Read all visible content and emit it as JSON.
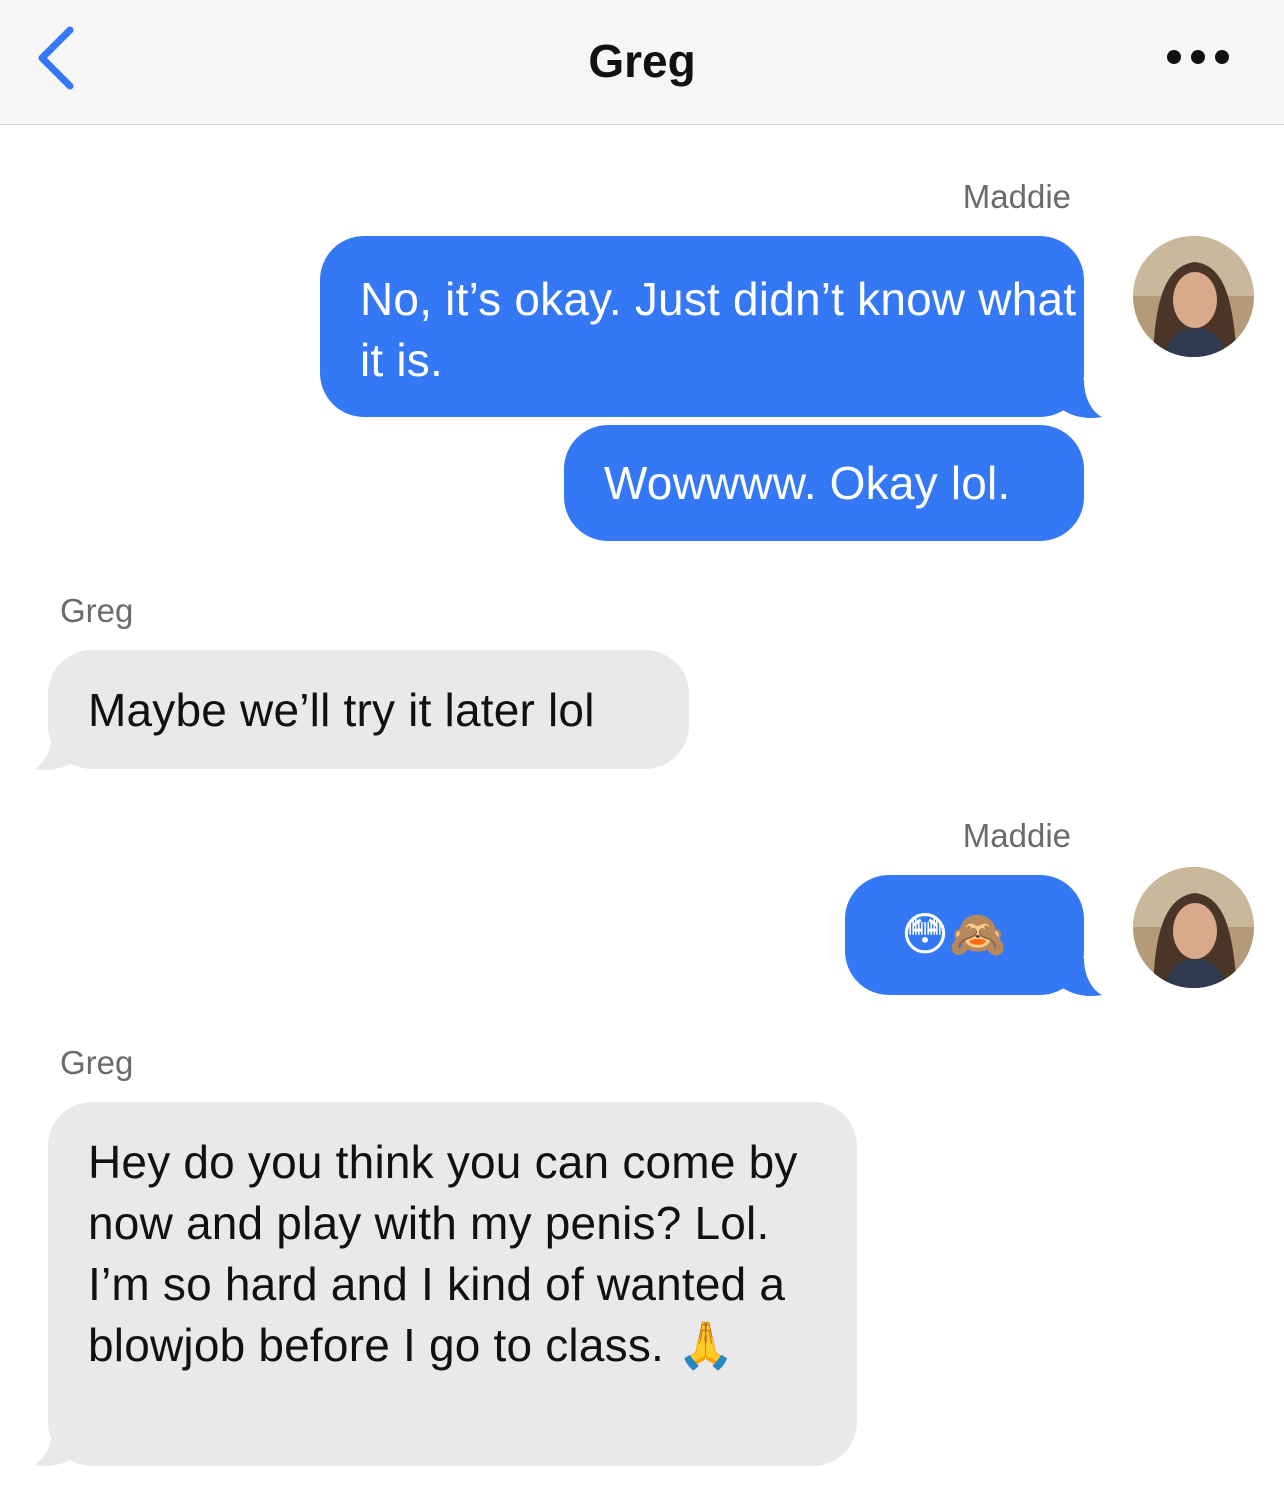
{
  "header": {
    "title": "Greg",
    "back_icon": "chevron-left-icon",
    "more_icon": "ellipsis-icon",
    "accent_color": "#3478f6"
  },
  "messages": [
    {
      "sender": "Maddie",
      "direction": "outgoing",
      "text": "No, it’s okay. Just didn’t know what it is."
    },
    {
      "direction": "outgoing",
      "text": "Wowwww. Okay lol."
    },
    {
      "sender": "Greg",
      "direction": "incoming",
      "text": "Maybe we’ll try it later lol"
    },
    {
      "sender": "Maddie",
      "direction": "outgoing",
      "text": "😳🙈"
    },
    {
      "sender": "Greg",
      "direction": "incoming",
      "text": "Hey do you think you can come by now and play with my penis? Lol. I’m so hard and I kind of wanted a blowjob before I go to class. 🙏"
    }
  ],
  "colors": {
    "outgoing_bubble": "#3478f6",
    "incoming_bubble": "#e9e9eb",
    "sender_label": "#6b6b6f"
  }
}
